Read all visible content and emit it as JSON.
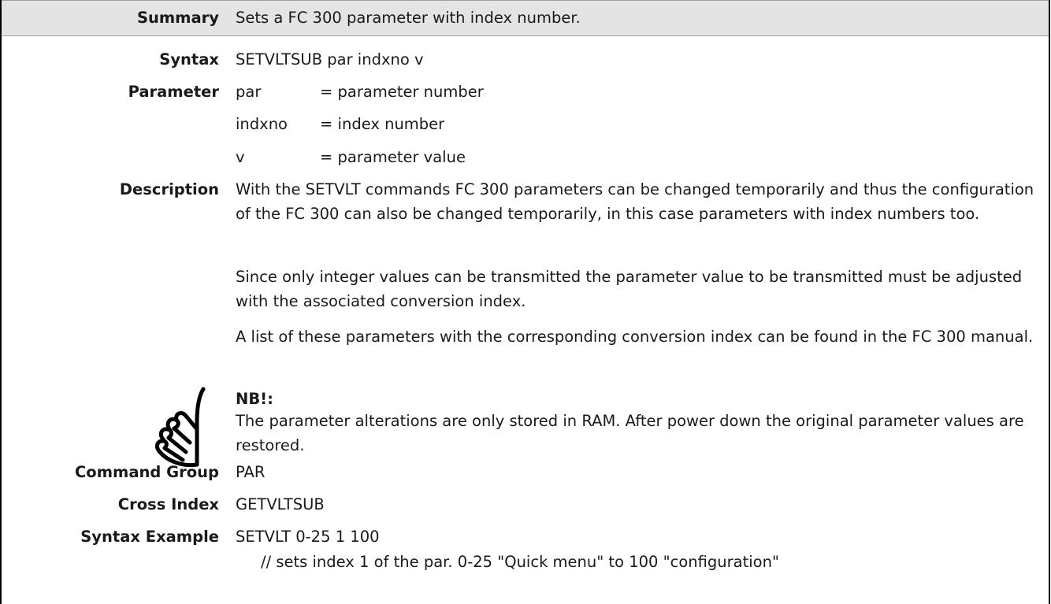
{
  "summary": {
    "label": "Summary",
    "text": "Sets a FC 300 parameter with index number."
  },
  "syntax": {
    "label": "Syntax",
    "text": "SETVLTSUB par indxno v"
  },
  "parameter": {
    "label": "Parameter",
    "items": [
      {
        "name": "par",
        "desc": "= parameter number"
      },
      {
        "name": "indxno",
        "desc": "= index number"
      },
      {
        "name": "v",
        "desc": "= parameter value"
      }
    ]
  },
  "description": {
    "label": "Description",
    "paragraphs": [
      "With the SETVLT commands FC 300 parameters can be changed temporarily and thus the configuration of the FC 300 can also be changed temporarily, in this case parameters with index numbers too.",
      "Since only integer values can be transmitted the parameter value to be transmitted must be adjusted with the associated conversion index.",
      "A list of these parameters with the corresponding conversion index can be found in the FC 300 manual."
    ]
  },
  "note": {
    "title": "NB!:",
    "text": "The parameter alterations are only stored in RAM. After power down the original parameter values are restored.",
    "icon": "hand-note-icon"
  },
  "command_group": {
    "label": "Command Group",
    "text": "PAR"
  },
  "cross_index": {
    "label": "Cross Index",
    "text": "GETVLTSUB"
  },
  "syntax_example": {
    "label": "Syntax Example",
    "code": "SETVLT 0-25 1 100",
    "comment": "// sets index 1 of the par. 0-25 \"Quick menu\" to 100 \"configuration\""
  }
}
